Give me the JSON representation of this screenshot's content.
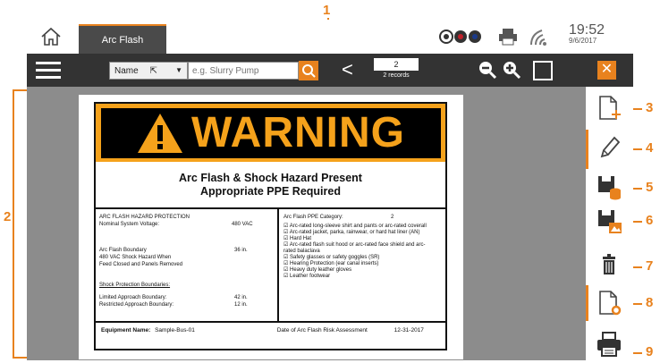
{
  "callouts": [
    "1",
    "2",
    "3",
    "4",
    "5",
    "6",
    "7",
    "8",
    "9"
  ],
  "tab": {
    "label": "Arc Flash"
  },
  "status": {
    "time": "19:52",
    "date": "9/6/2017"
  },
  "toolbar": {
    "field_select": "Name",
    "search_placeholder": "e.g. Slurry Pump",
    "record_value": "2",
    "record_count": "2 records"
  },
  "icons": {
    "home": "home-icon",
    "menu": "menu-icon",
    "search": "search-icon",
    "prev": "chevron-left-icon",
    "zoom_out": "zoom-out-icon",
    "zoom_in": "zoom-in-icon",
    "fit": "fit-to-page-icon",
    "close": "close-icon",
    "sidebar": [
      "new-document-icon",
      "pencil-icon",
      "save-to-database-icon",
      "save-as-image-icon",
      "trash-icon",
      "document-settings-icon",
      "printer-icon"
    ]
  },
  "colors": {
    "accent": "#e8821e",
    "toolbar": "#333333",
    "warning": "#f5a21b"
  },
  "label": {
    "banner": "WARNING",
    "title1": "Arc Flash & Shock Hazard Present",
    "title2": "Appropriate PPE Required",
    "left": {
      "heading": "ARC FLASH HAZARD PROTECTION",
      "nominal_label": "Nominal System Voltage:",
      "nominal_value": "480 VAC",
      "boundary_label": "Arc Flash Boundary",
      "boundary_value": "36 in.",
      "shock_line1": "480 VAC Shock Hazard When",
      "shock_line2": "Feed Closed and Panels Removed",
      "spb_heading": "Shock Protection Boundaries:",
      "limited_label": "Limited Approach Boundary:",
      "limited_value": "42 in.",
      "restricted_label": "Restricted Approach Boundary:",
      "restricted_value": "12 in."
    },
    "right": {
      "category_label": "Arc Flash PPE Category:",
      "category_value": "2",
      "ppe": [
        "☑ Arc-rated long-sleeve shirt and pants or arc-rated coverall",
        "☑ Arc-rated jacket, parka, rainwear, or hard hat liner (AN)",
        "☑ Hard Hat",
        "☑ Arc-rated flash suit hood or arc-rated face shield and arc-",
        "rated balaclava",
        "☑ Safety glasses or safety goggles (SR)",
        "☑ Hearing Protection (ear canal inserts)",
        "☑ Heavy duty leather gloves",
        "☑ Leather footwear"
      ]
    },
    "footer": {
      "equipment_label": "Equipment Name:",
      "equipment_value": "Sample-Bus-01",
      "date_label": "Date of Arc Flash Risk Assessment",
      "date_value": "12-31-2017"
    }
  }
}
